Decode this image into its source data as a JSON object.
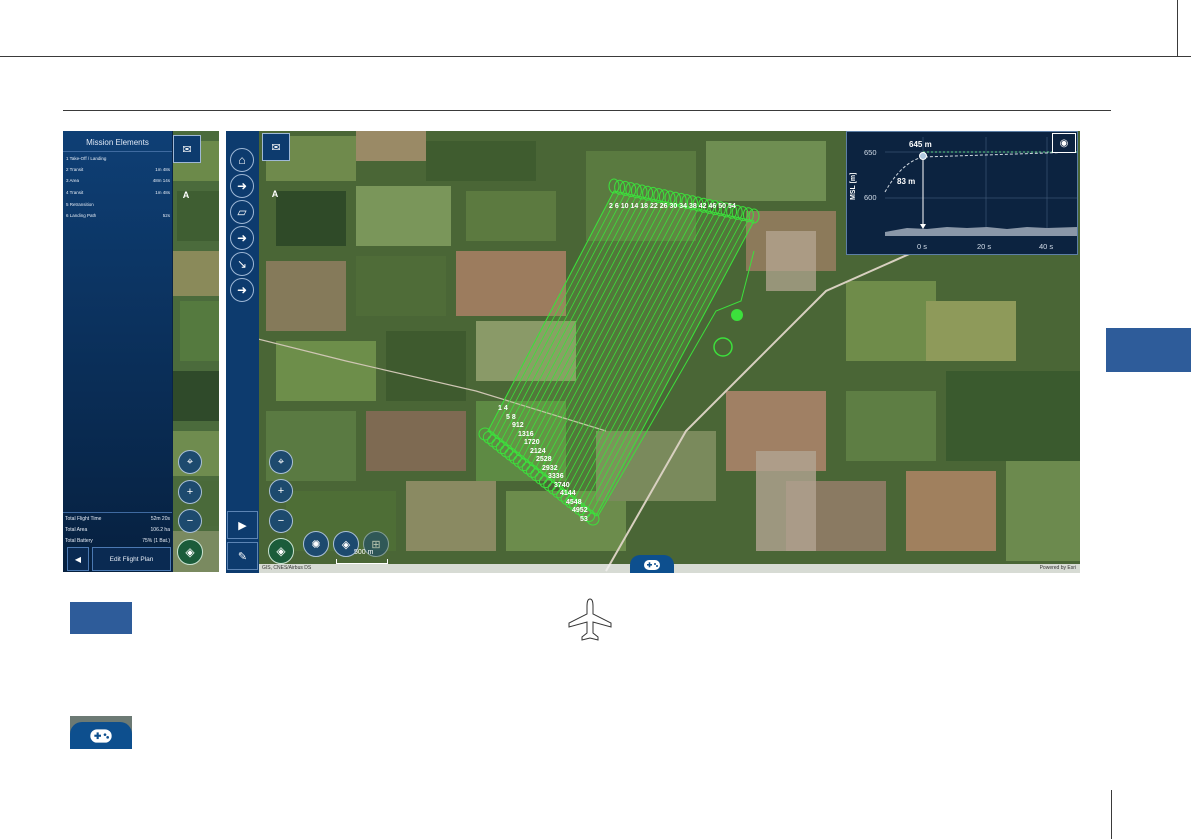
{
  "mission_panel": {
    "title": "Mission Elements",
    "elements": [
      {
        "label": "1  Take-Off / Landing",
        "time": ""
      },
      {
        "label": "2  Transit",
        "time": "1m 48s"
      },
      {
        "label": "3  Area",
        "time": "48m 14s"
      },
      {
        "label": "4  Transit",
        "time": "1m 48s"
      },
      {
        "label": "5  Retransition",
        "time": ""
      },
      {
        "label": "6  Landing Path",
        "time": "52s"
      }
    ],
    "totals": [
      {
        "label": "Total Flight Time",
        "value": "52m 20s"
      },
      {
        "label": "Total Area",
        "value": "106.2 ha"
      },
      {
        "label": "Total Battery",
        "value": "75% (1 Bat.)"
      }
    ],
    "back_label": "◀",
    "edit_label": "Edit Flight Plan"
  },
  "map": {
    "connection_label": "A",
    "scale_label": "500 m",
    "attribution": "GIS, CNES/Airbus DS",
    "powered_by": "Powered by Esri",
    "waypoint_labels": [
      "2",
      "6",
      "10",
      "14",
      "18",
      "22",
      "26",
      "30",
      "34",
      "38",
      "42",
      "46",
      "50",
      "54",
      "1",
      "4",
      "5",
      "8",
      "9",
      "12",
      "13",
      "16",
      "17",
      "20",
      "21",
      "24",
      "25",
      "28",
      "29",
      "32",
      "33",
      "36",
      "37",
      "40",
      "41",
      "44",
      "45",
      "48",
      "49",
      "52",
      "53"
    ]
  },
  "profile": {
    "altitude_label": "645 m",
    "agl_label": "83 m",
    "y_axis_title": "MSL [m]",
    "y_ticks": [
      "650",
      "600"
    ],
    "x_ticks": [
      "0 s",
      "20 s",
      "40 s"
    ]
  },
  "icons": {
    "message": "envelope-icon",
    "connection": "signal-icon",
    "home": "home-icon",
    "arrow": "arrow-right-icon",
    "area": "parallelogram-icon",
    "landing": "landing-icon",
    "center": "center-map-icon",
    "zoom_in": "zoom-in-icon",
    "zoom_out": "zoom-out-icon",
    "layers": "layers-icon",
    "expand": "triangle-right-icon",
    "edit": "pencil-icon",
    "gamepad": "gamepad-icon",
    "eye": "eye-icon",
    "plane": "airplane-icon"
  },
  "colors": {
    "panel_blue": "#0d3b6e",
    "flight_path": "#3ce03c",
    "accent_blue": "#2e5c9a"
  }
}
